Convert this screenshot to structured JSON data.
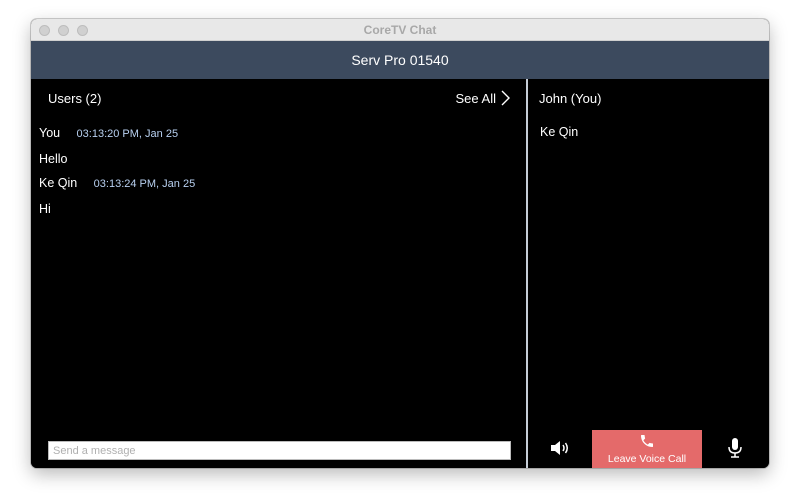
{
  "window": {
    "title": "CoreTV Chat"
  },
  "header": {
    "title": "Serv Pro 01540"
  },
  "users_panel": {
    "title": "Users (2)",
    "see_all_label": "See All",
    "see_all_icon": "chevron-right-icon"
  },
  "messages": [
    {
      "sender": "You",
      "time": "03:13:20 PM, Jan 25",
      "text": "Hello"
    },
    {
      "sender": "Ke Qin",
      "time": "03:13:24 PM, Jan 25",
      "text": "Hi"
    }
  ],
  "message_input": {
    "value": "",
    "placeholder": "Send a message"
  },
  "voice_panel": {
    "current_user": "John (You)",
    "participants": [
      "Ke Qin"
    ],
    "speaker_icon": "speaker-icon",
    "leave_label": "Leave Voice Call",
    "leave_icon": "phone-icon",
    "mic_icon": "microphone-icon"
  },
  "colors": {
    "header_bg": "#3c4a5e",
    "panel_bg": "#000000",
    "timestamp": "#b8d0f0",
    "leave_button": "#e46a6a"
  }
}
